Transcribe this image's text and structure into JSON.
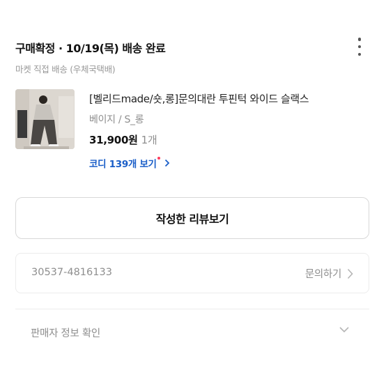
{
  "header": {
    "status_title": "구매확정 · 10/19(목) 배송 완료",
    "shipping_info": "마켓 직접 배송 (우체국택배)",
    "more_icon": "more-vertical-icon"
  },
  "product": {
    "name": "[벨리드made/숏,롱]문의대란 투핀턱 와이드 슬랙스",
    "option": "베이지 / S_롱",
    "price": "31,900원",
    "quantity": "1개",
    "coordi_link": "코디 139개 보기",
    "colors": {
      "coordi_link": "#1a5ec8",
      "new_dot": "#ff3b5c"
    }
  },
  "actions": {
    "review_button": "작성한 리뷰보기"
  },
  "order": {
    "order_number": "30537-4816133",
    "inquiry_label": "문의하기"
  },
  "seller": {
    "label": "판매자 정보 확인"
  },
  "bottom": {
    "text_prefix": "",
    "text_highlight": "",
    "text_suffix": "",
    "highlight_color": "#ff4f86"
  }
}
